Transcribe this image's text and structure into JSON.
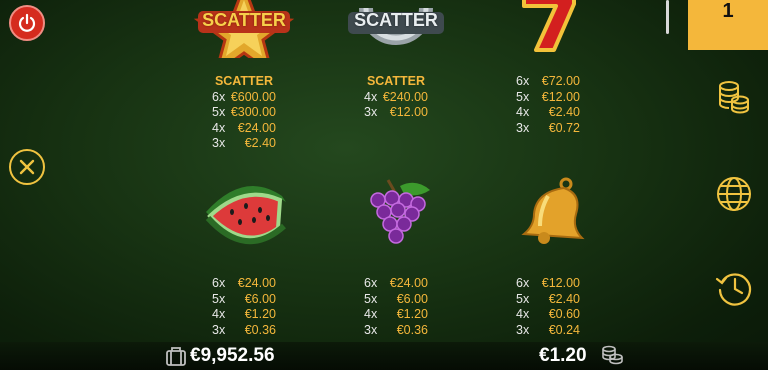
{
  "page_indicator": "1",
  "symbols": [
    {
      "name": "scatter-star",
      "label": "SCATTER",
      "title": "SCATTER",
      "pays": [
        {
          "mult": "6x",
          "amount": "€600.00"
        },
        {
          "mult": "5x",
          "amount": "€300.00"
        },
        {
          "mult": "4x",
          "amount": "€24.00"
        },
        {
          "mult": "3x",
          "amount": "€2.40"
        }
      ]
    },
    {
      "name": "scatter-horseshoe",
      "label": "SCATTER",
      "title": "SCATTER",
      "pays": [
        {
          "mult": "4x",
          "amount": "€240.00"
        },
        {
          "mult": "3x",
          "amount": "€12.00"
        }
      ]
    },
    {
      "name": "seven",
      "pays": [
        {
          "mult": "6x",
          "amount": "€72.00"
        },
        {
          "mult": "5x",
          "amount": "€12.00"
        },
        {
          "mult": "4x",
          "amount": "€2.40"
        },
        {
          "mult": "3x",
          "amount": "€0.72"
        }
      ]
    },
    {
      "name": "watermelon",
      "pays": [
        {
          "mult": "6x",
          "amount": "€24.00"
        },
        {
          "mult": "5x",
          "amount": "€6.00"
        },
        {
          "mult": "4x",
          "amount": "€1.20"
        },
        {
          "mult": "3x",
          "amount": "€0.36"
        }
      ]
    },
    {
      "name": "grapes",
      "pays": [
        {
          "mult": "6x",
          "amount": "€24.00"
        },
        {
          "mult": "5x",
          "amount": "€6.00"
        },
        {
          "mult": "4x",
          "amount": "€1.20"
        },
        {
          "mult": "3x",
          "amount": "€0.36"
        }
      ]
    },
    {
      "name": "bell",
      "pays": [
        {
          "mult": "6x",
          "amount": "€12.00"
        },
        {
          "mult": "5x",
          "amount": "€2.40"
        },
        {
          "mult": "4x",
          "amount": "€0.60"
        },
        {
          "mult": "3x",
          "amount": "€0.24"
        }
      ]
    }
  ],
  "footer": {
    "balance": "€9,952.56",
    "bet": "€1.20"
  },
  "colors": {
    "accent": "#f4b73b",
    "power": "#d52b1e",
    "background": "#173212"
  },
  "icons": [
    "power-icon",
    "close-icon",
    "coins-icon",
    "globe-icon",
    "history-icon",
    "wallet-icon"
  ]
}
